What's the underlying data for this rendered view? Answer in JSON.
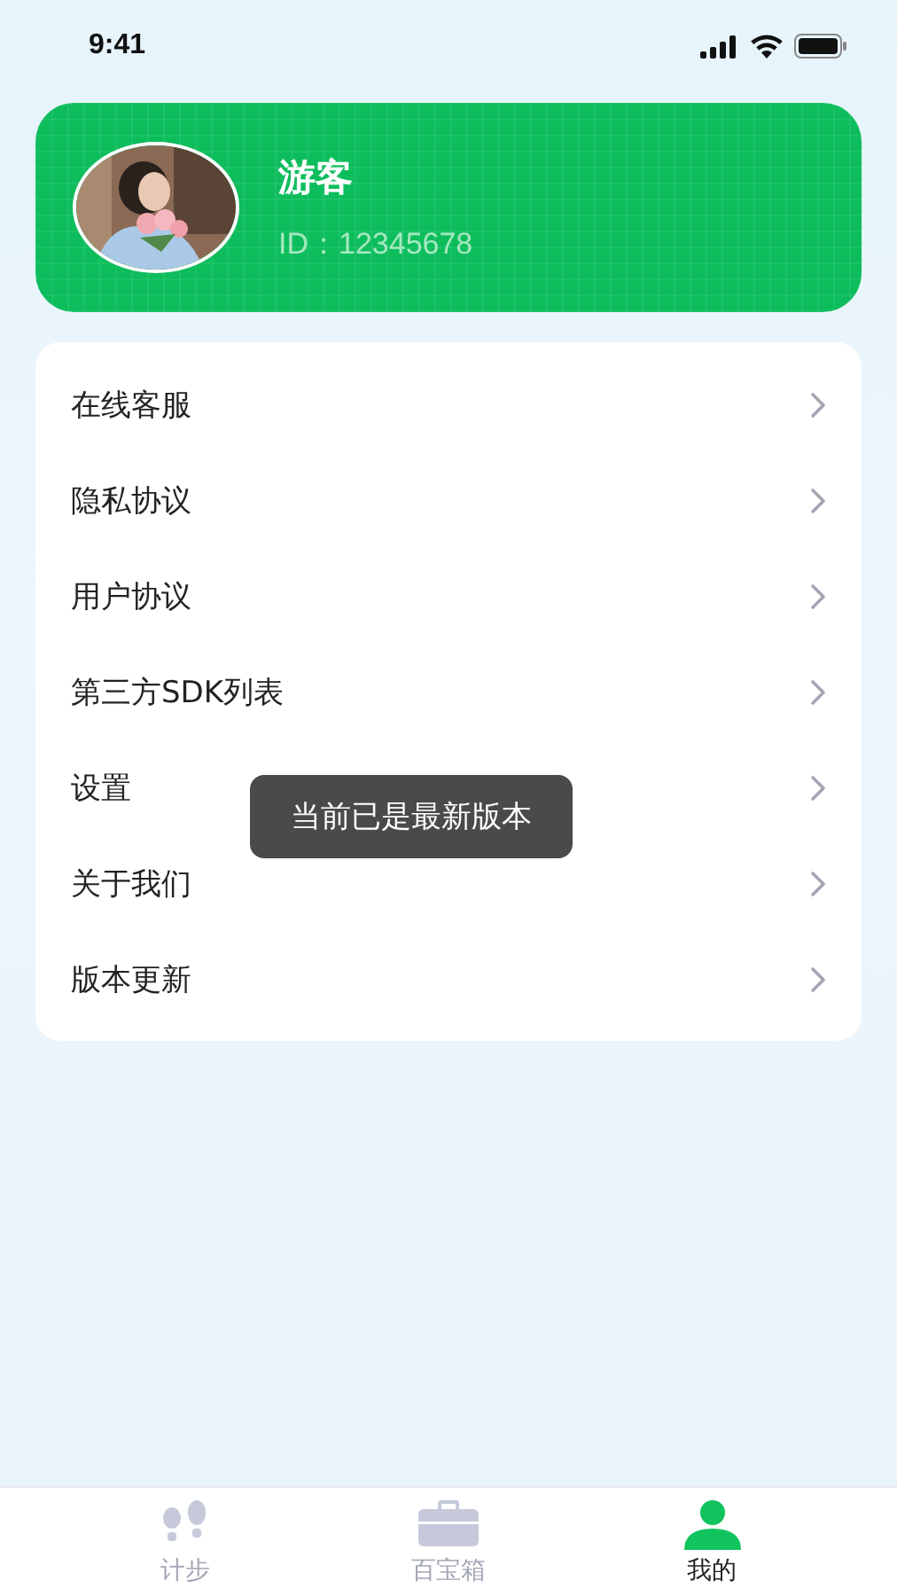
{
  "status_bar": {
    "time": "9:41"
  },
  "profile": {
    "name": "游客",
    "id": "ID：12345678"
  },
  "menu": [
    {
      "label": "在线客服"
    },
    {
      "label": "隐私协议"
    },
    {
      "label": "用户协议"
    },
    {
      "label": "第三方SDK列表"
    },
    {
      "label": "设置"
    },
    {
      "label": "关于我们"
    },
    {
      "label": "版本更新"
    }
  ],
  "toast": "当前已是最新版本",
  "tabs": [
    {
      "label": "计步",
      "selected": false
    },
    {
      "label": "百宝箱",
      "selected": false
    },
    {
      "label": "我的",
      "selected": true
    }
  ]
}
